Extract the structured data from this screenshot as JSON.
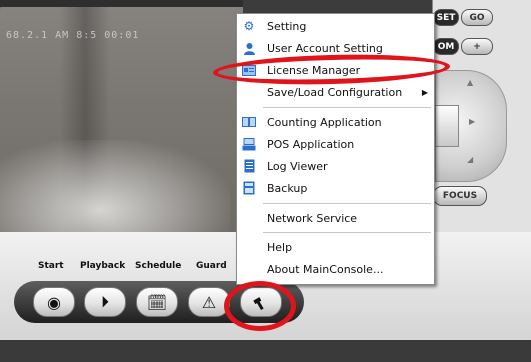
{
  "camera": {
    "overlay_text": "68.2.1        AM 8:5          00:01"
  },
  "right_panel": {
    "set_label": "SET",
    "go_label": "GO",
    "zoom_label": "OM",
    "plus_label": "+",
    "focus_label": "FOCUS"
  },
  "toolbar": {
    "labels": {
      "start": "Start",
      "playback": "Playback",
      "schedule": "Schedule",
      "guard": "Guard"
    }
  },
  "menu": {
    "items": [
      {
        "label": "Setting",
        "icon": "gear-icon"
      },
      {
        "label": "User Account Setting",
        "icon": "user-icon"
      },
      {
        "label": "License Manager",
        "icon": "license-card-icon"
      },
      {
        "label": "Save/Load Configuration",
        "icon": "none",
        "submenu": true
      },
      {
        "label": "Counting Application",
        "icon": "counting-icon"
      },
      {
        "label": "POS Application",
        "icon": "pos-terminal-icon"
      },
      {
        "label": "Log Viewer",
        "icon": "log-document-icon"
      },
      {
        "label": "Backup",
        "icon": "backup-icon"
      },
      {
        "label": "Network Service",
        "icon": "none"
      },
      {
        "label": "Help",
        "icon": "none"
      },
      {
        "label": "About MainConsole...",
        "icon": "none"
      }
    ]
  },
  "colors": {
    "highlight": "#e0141b",
    "icon_blue": "#2a6fc9"
  }
}
